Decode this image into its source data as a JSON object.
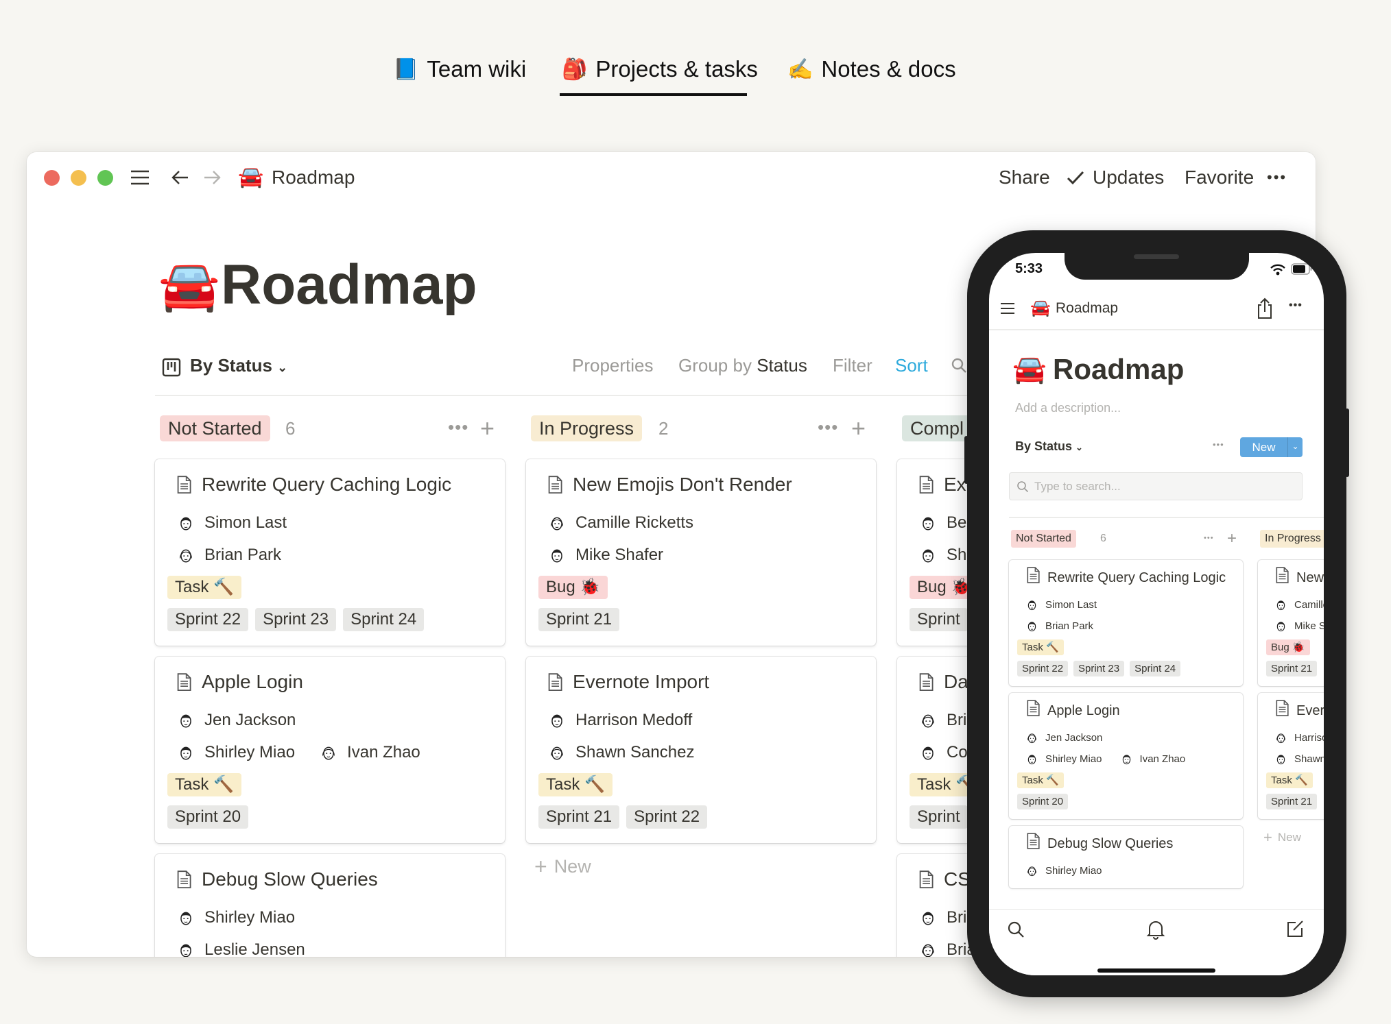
{
  "top_tabs": [
    {
      "icon": "📘",
      "label": "Team wiki",
      "active": false
    },
    {
      "icon": "🎒",
      "label": "Projects & tasks",
      "active": true
    },
    {
      "icon": "✍️",
      "label": "Notes & docs",
      "active": false
    }
  ],
  "colors": {
    "background": "#f7f6f2",
    "accent_blue": "#2eaadc",
    "not_started": "#f9d8d6",
    "in_progress": "#f8ecd2",
    "complete": "#dbe6e0",
    "task_tag": "#f9eecb",
    "bug_tag": "#fad6d6",
    "sprint_tag": "#e8e8e6",
    "new_button": "#5fa7e0"
  },
  "window": {
    "breadcrumb_icon": "🚘",
    "breadcrumb": "Roadmap",
    "share": "Share",
    "updates": "Updates",
    "favorite": "Favorite",
    "more": "•••"
  },
  "page": {
    "icon": "🚘",
    "title": "Roadmap",
    "view_name": "By Status",
    "properties": "Properties",
    "group_by": "Group by",
    "group_by_value": "Status",
    "filter": "Filter",
    "sort": "Sort"
  },
  "board": {
    "columns": [
      {
        "label": "Not Started",
        "count": "6",
        "kind": "not_started",
        "show_actions": true,
        "cards": [
          {
            "title": "Rewrite Query Caching Logic",
            "people": [
              [
                "Simon Last"
              ],
              [
                "Brian Park"
              ]
            ],
            "type": {
              "label": "Task 🔨",
              "kind": "task"
            },
            "sprints": [
              "Sprint 22",
              "Sprint 23",
              "Sprint 24"
            ]
          },
          {
            "title": "Apple Login",
            "people": [
              [
                "Jen Jackson"
              ],
              [
                "Shirley Miao",
                "Ivan Zhao"
              ]
            ],
            "type": {
              "label": "Task 🔨",
              "kind": "task"
            },
            "sprints": [
              "Sprint 20"
            ]
          },
          {
            "title": "Debug Slow Queries",
            "people": [
              [
                "Shirley Miao"
              ],
              [
                "Leslie Jensen"
              ]
            ],
            "type": null,
            "sprints": []
          }
        ]
      },
      {
        "label": "In Progress",
        "count": "2",
        "kind": "in_progress",
        "show_actions": true,
        "cards": [
          {
            "title": "New Emojis Don't Render",
            "people": [
              [
                "Camille Ricketts"
              ],
              [
                "Mike Shafer"
              ]
            ],
            "type": {
              "label": "Bug 🐞",
              "kind": "bug"
            },
            "sprints": [
              "Sprint 21"
            ]
          },
          {
            "title": "Evernote Import",
            "people": [
              [
                "Harrison Medoff"
              ],
              [
                "Shawn Sanchez"
              ]
            ],
            "type": {
              "label": "Task 🔨",
              "kind": "task"
            },
            "sprints": [
              "Sprint 21",
              "Sprint 22"
            ]
          }
        ],
        "new_label": "New"
      },
      {
        "label": "Compl",
        "count": "",
        "kind": "complete",
        "show_actions": false,
        "cards": [
          {
            "title": "Exc",
            "people": [
              [
                "Bee"
              ],
              [
                "Shir"
              ]
            ],
            "type": {
              "label": "Bug 🐞",
              "kind": "bug"
            },
            "sprints": [
              "Sprint"
            ]
          },
          {
            "title": "Dat",
            "people": [
              [
                "Bria"
              ],
              [
                "Cor"
              ]
            ],
            "type": {
              "label": "Task 🔨",
              "kind": "task"
            },
            "sprints": [
              "Sprint"
            ]
          },
          {
            "title": "CSV",
            "people": [
              [
                "Bria"
              ],
              [
                "Bria"
              ]
            ],
            "type": null,
            "sprints": []
          }
        ]
      }
    ]
  },
  "phone": {
    "time": "5:33",
    "nav_title": "Roadmap",
    "nav_icon": "🚘",
    "title": "Roadmap",
    "description_placeholder": "Add a description...",
    "view_name": "By Status",
    "new_button": "New",
    "search_placeholder": "Type to search...",
    "columns": [
      {
        "label": "Not Started",
        "count": "6",
        "kind": "not_started",
        "cards": [
          {
            "title": "Rewrite Query Caching Logic",
            "people": [
              [
                "Simon Last"
              ],
              [
                "Brian Park"
              ]
            ],
            "type": {
              "label": "Task 🔨",
              "kind": "task"
            },
            "sprints": [
              "Sprint 22",
              "Sprint 23",
              "Sprint 24"
            ]
          },
          {
            "title": "Apple Login",
            "people": [
              [
                "Jen Jackson"
              ],
              [
                "Shirley Miao",
                "Ivan Zhao"
              ]
            ],
            "type": {
              "label": "Task 🔨",
              "kind": "task"
            },
            "sprints": [
              "Sprint 20"
            ]
          },
          {
            "title": "Debug Slow Queries",
            "people": [
              [
                "Shirley Miao"
              ]
            ],
            "type": null,
            "sprints": []
          }
        ]
      },
      {
        "label": "In Progress",
        "count": "",
        "kind": "in_progress",
        "cards": [
          {
            "title": "New Emojis Don't Render",
            "people": [
              [
                "Camille Ricketts"
              ],
              [
                "Mike Shafer"
              ]
            ],
            "type": {
              "label": "Bug 🐞",
              "kind": "bug"
            },
            "sprints": [
              "Sprint 21"
            ]
          },
          {
            "title": "Evernote Import",
            "people": [
              [
                "Harrison Medoff"
              ],
              [
                "Shawn Sanchez"
              ]
            ],
            "type": {
              "label": "Task 🔨",
              "kind": "task"
            },
            "sprints": [
              "Sprint 21"
            ]
          }
        ],
        "new_label": "New"
      }
    ]
  }
}
